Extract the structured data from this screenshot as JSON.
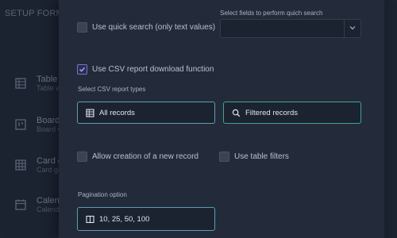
{
  "background": {
    "title": "SETUP FORM",
    "items": [
      {
        "label": "Table",
        "sub": "Table ve",
        "icon": "table-icon"
      },
      {
        "label": "Board",
        "sub": "Board vi",
        "icon": "board-icon"
      },
      {
        "label": "Card ga",
        "sub": "Card ga",
        "icon": "card-gallery-icon"
      },
      {
        "label": "Calend",
        "sub": "Calend",
        "icon": "calendar-icon"
      }
    ]
  },
  "form": {
    "quick_search": {
      "label": "Use quick search (only text values)",
      "checked": false
    },
    "quick_search_fields": {
      "label": "Select fields to perform quich search",
      "value": ""
    },
    "csv_download": {
      "label": "Use CSV report download function",
      "checked": true
    },
    "csv_types_label": "Select CSV report types",
    "csv_types": [
      {
        "label": "All records",
        "icon": "table-icon"
      },
      {
        "label": "Filtered records",
        "icon": "search-icon"
      }
    ],
    "allow_new_record": {
      "label": "Allow creation of a new record",
      "checked": false
    },
    "table_filters": {
      "label": "Use table filters",
      "checked": false
    },
    "pagination_label": "Pagination option",
    "pagination_value": "10, 25, 50, 100"
  },
  "colors": {
    "panel": "#232b3b",
    "accent_purple": "#7d6cdb",
    "accent_teal": "#3aa890"
  }
}
